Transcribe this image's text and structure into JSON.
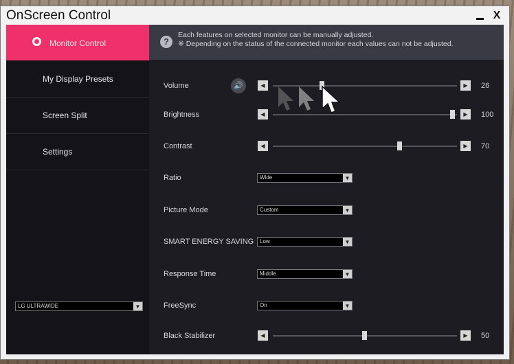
{
  "window": {
    "title": "OnScreen Control",
    "minimize_label": "_",
    "close_label": "X"
  },
  "sidebar": {
    "items": [
      {
        "label": "Monitor Control",
        "active": true
      },
      {
        "label": "My Display Presets",
        "active": false
      },
      {
        "label": "Screen Split",
        "active": false
      },
      {
        "label": "Settings",
        "active": false
      }
    ],
    "monitor_select_value": "LG ULTRAWIDE"
  },
  "info": {
    "line1": "Each features on selected monitor can be manually adjusted.",
    "line2": "※ Depending on the status of the connected monitor each values can not be adjusted."
  },
  "controls": {
    "volume": {
      "label": "Volume",
      "value": "26"
    },
    "brightness": {
      "label": "Brightness",
      "value": "100"
    },
    "contrast": {
      "label": "Contrast",
      "value": "70"
    },
    "ratio": {
      "label": "Ratio",
      "value": "Wide"
    },
    "picture_mode": {
      "label": "Picture Mode",
      "value": "Custom"
    },
    "smart_energy_saving": {
      "label": "SMART ENERGY SAVING",
      "value": "Low"
    },
    "response_time": {
      "label": "Response Time",
      "value": "Middle"
    },
    "freesync": {
      "label": "FreeSync",
      "value": "On"
    },
    "black_stabilizer": {
      "label": "Black Stabilizer",
      "value": "50"
    }
  },
  "colors": {
    "accent": "#f0306a",
    "panel": "#1d1c22",
    "sidebar": "#141418"
  },
  "icons": {
    "left_arrow": "◀",
    "right_arrow": "▶",
    "down_arrow": "▼",
    "speaker": "🔊",
    "help": "?"
  }
}
